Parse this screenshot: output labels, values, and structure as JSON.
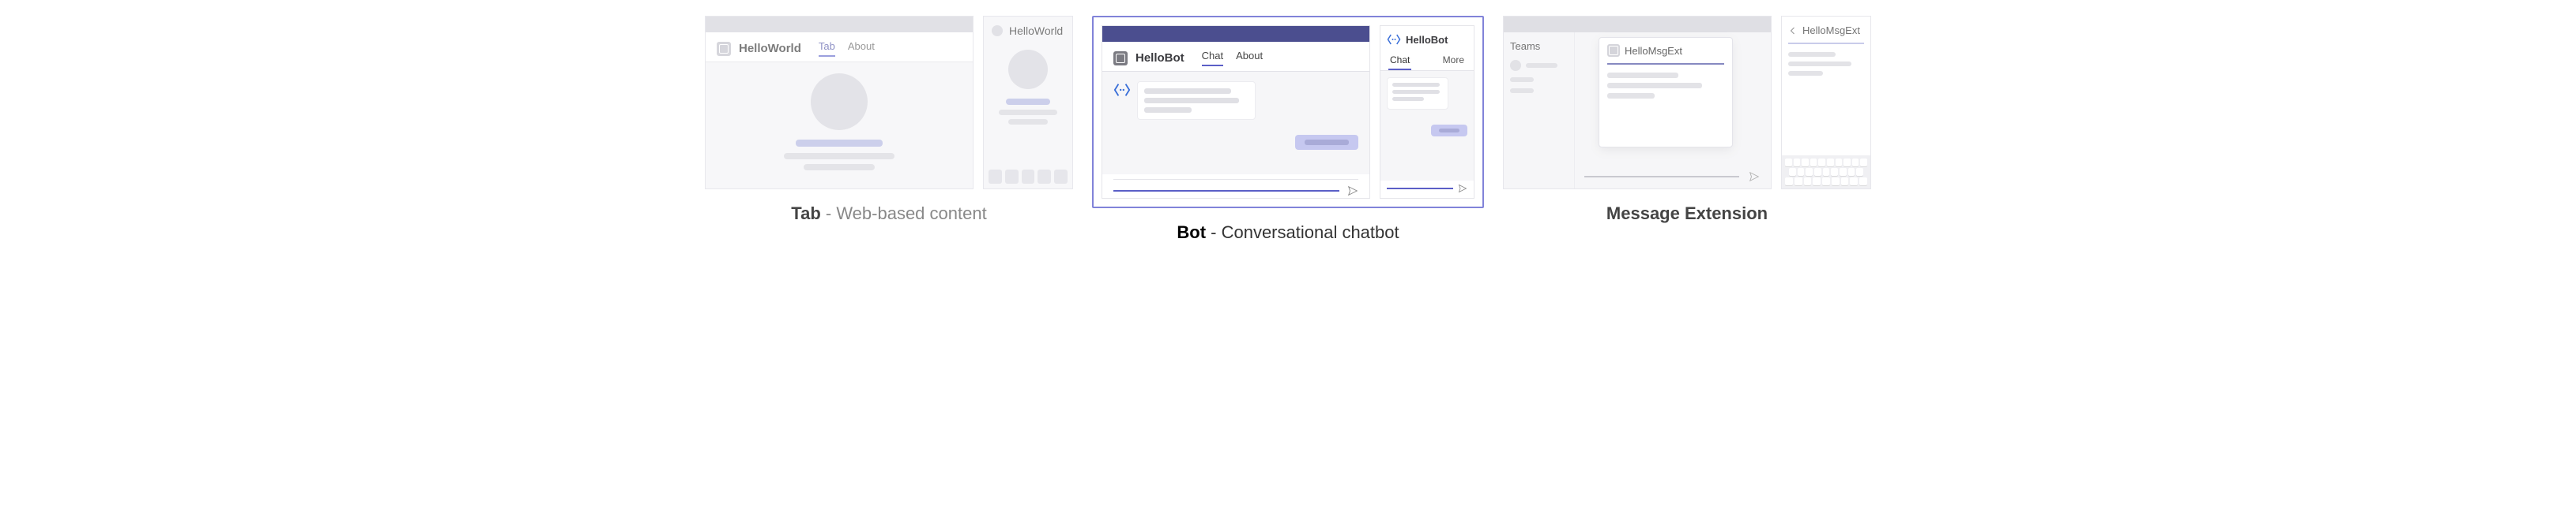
{
  "sections": {
    "tab": {
      "desktop": {
        "title": "HelloWorld",
        "tabs": [
          "Tab",
          "About"
        ],
        "active_tab": "Tab"
      },
      "mobile": {
        "title": "HelloWorld"
      },
      "caption_bold": "Tab",
      "caption_rest": " - Web-based content"
    },
    "bot": {
      "desktop": {
        "title": "HelloBot",
        "tabs": [
          "Chat",
          "About"
        ],
        "active_tab": "Chat"
      },
      "mobile": {
        "title": "HelloBot",
        "tabs": [
          "Chat",
          "More"
        ],
        "active_tab": "Chat"
      },
      "caption_bold": "Bot",
      "caption_rest": " - Conversational chatbot",
      "highlighted": true
    },
    "ext": {
      "desktop": {
        "sidebar_title": "Teams",
        "popup_title": "HelloMsgExt"
      },
      "mobile": {
        "title": "HelloMsgExt"
      },
      "caption_bold": "Message Extension",
      "caption_rest": ""
    }
  },
  "colors": {
    "accent": "#5b5fc7",
    "muted_accent": "#c6c8f0",
    "neutral_bar": "#dcdce2",
    "dark_bar": "#4b4e8f"
  }
}
